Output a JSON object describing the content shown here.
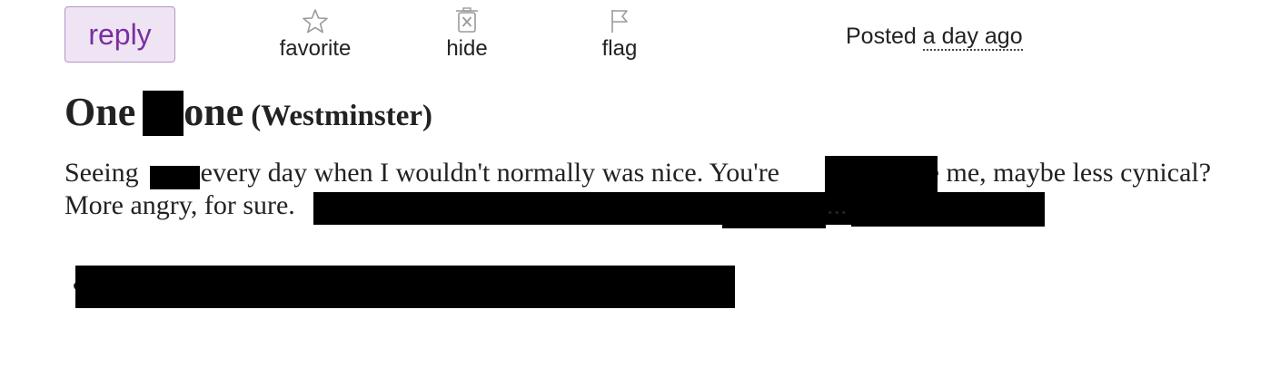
{
  "actions": {
    "reply_label": "reply",
    "favorite_label": "favorite",
    "favorite_icon": "star-icon",
    "hide_label": "hide",
    "hide_icon": "trash-x-icon",
    "flag_label": "flag",
    "flag_icon": "flag-icon"
  },
  "posted": {
    "prefix": "Posted",
    "time": "a day ago"
  },
  "post": {
    "title_part1": "One",
    "title_part2": "one",
    "location": "(Westminster)",
    "line1_a": "Seeing",
    "line1_b": "every day when I wouldn't normally was nice. You're",
    "line1_c": "like me, maybe less cynical?",
    "line2_a": "More angry, for sure.",
    "ellipsis": "..."
  },
  "colors": {
    "reply_bg": "#eee4f3",
    "reply_border": "#b197c4",
    "reply_text": "#7a2ea0",
    "redaction": "#000000",
    "text": "#222222"
  }
}
